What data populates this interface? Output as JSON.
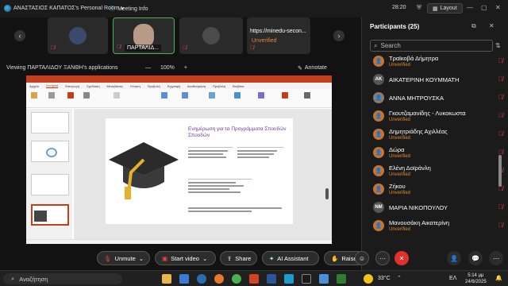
{
  "titlebar": {
    "room": "ΑΝΑΣΤΑΣΙΟΣ ΚΑΠΑΤΟΣ's Personal Room",
    "meeting": "Meeting Info",
    "time": "28:20",
    "layout": "Layout"
  },
  "thumbnails": [
    {
      "name": ""
    },
    {
      "name": "ΠΑΡΤΑΛΙΔ..."
    },
    {
      "name": ""
    },
    {
      "url": "https://minedu-secon...",
      "status": "Unverified"
    }
  ],
  "viewing": {
    "label": "Viewing ΠΑΡΤΑΛΙΔΟΥ ΞΑΝΘΗ's applications",
    "zoom_out": "—",
    "zoom": "100%",
    "zoom_in": "+",
    "annotate": "Annotate"
  },
  "slide": {
    "title": "Ενημέρωση για τα Προγράμματα Σπουδών Σπουδών"
  },
  "participants": {
    "title": "Participants (25)",
    "search_placeholder": "Search",
    "list": [
      {
        "name": "Τραϊκοβά Δήμητρα",
        "initials": "",
        "unverified": "Unverified",
        "avatar_color": "#c9732c"
      },
      {
        "name": "ΑΙΚΑΤΕΡΙΝΗ ΚΟΥΜΜΑΤΗ",
        "initials": "ΑΚ",
        "unverified": "",
        "avatar_color": "#555"
      },
      {
        "name": "ΑΝΝΑ ΜΗΤΡΟΥΣΚΑ",
        "initials": "",
        "unverified": "",
        "avatar_color": "#8a7d6a"
      },
      {
        "name": "Γκουτζαμανίδης - Λυκοκωστα",
        "initials": "",
        "unverified": "Unverified",
        "avatar_color": "#c9732c"
      },
      {
        "name": "Δημητριάδης Αχιλλέας",
        "initials": "",
        "unverified": "Unverified",
        "avatar_color": "#c9732c"
      },
      {
        "name": "Δώρα",
        "initials": "",
        "unverified": "Unverified",
        "avatar_color": "#c9732c"
      },
      {
        "name": "Ελένη Δοϊράνλη",
        "initials": "",
        "unverified": "Unverified",
        "avatar_color": "#c9732c"
      },
      {
        "name": "Ζήκου",
        "initials": "",
        "unverified": "Unverified",
        "avatar_color": "#c9732c"
      },
      {
        "name": "ΜΑΡΙΑ ΝΙΚΟΠΟΥΛΟΥ",
        "initials": "ΝΜ",
        "unverified": "",
        "avatar_color": "#555"
      },
      {
        "name": "Μανουσάκη Αικατερίνη",
        "initials": "",
        "unverified": "Unverified",
        "avatar_color": "#c9732c"
      }
    ]
  },
  "controls": {
    "unmute": "Unmute",
    "start_video": "Start video",
    "share": "Share",
    "ai": "AI Assistant",
    "raise": "Raise"
  },
  "taskbar": {
    "search": "Αναζήτηση",
    "weather": "33°C",
    "lang": "ΕΛ",
    "time": "5:14 μμ",
    "date": "24/6/2025"
  }
}
